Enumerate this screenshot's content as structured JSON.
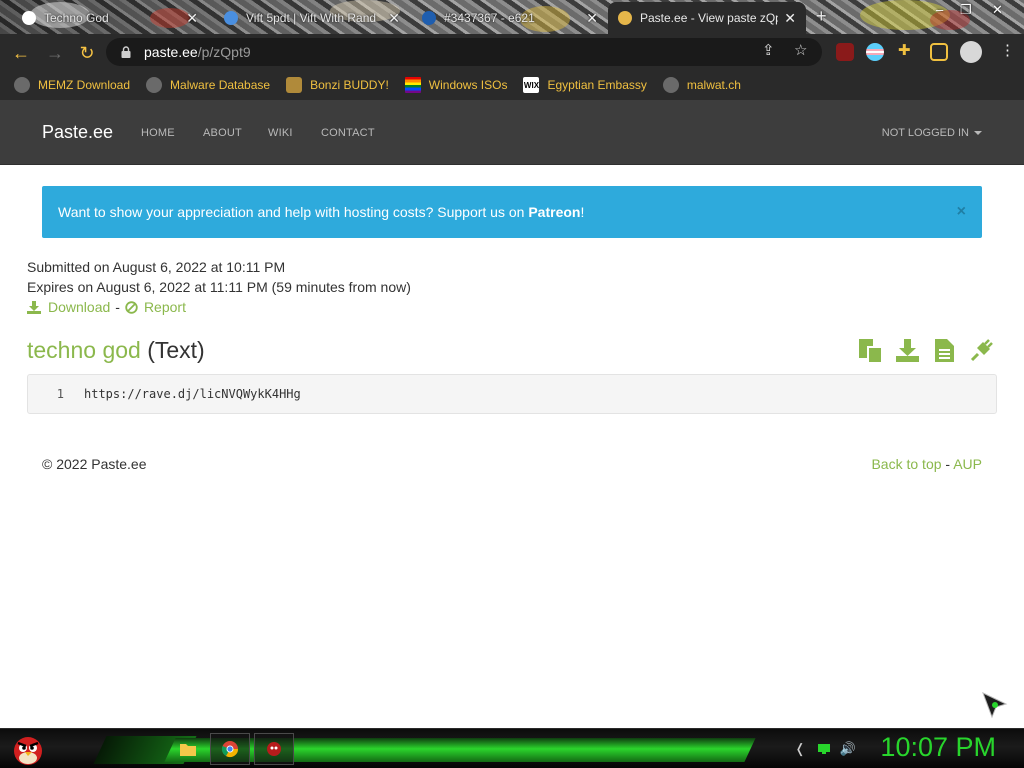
{
  "browser": {
    "tabs": [
      {
        "title": "Techno God",
        "favicon_color": "#ffffff",
        "active": false
      },
      {
        "title": "Vift 5pdt | Vift With Rand",
        "favicon_color": "#4a8fe0",
        "active": false
      },
      {
        "title": "#3437367 - e621",
        "favicon_color": "#1f5eaf",
        "active": false
      },
      {
        "title": "Paste.ee - View paste zQpt9",
        "favicon_color": "#e5b64a",
        "active": true
      }
    ],
    "new_tab": "+",
    "url_host": "paste.ee",
    "url_path": "/p/zQpt9",
    "extension_badge": "1",
    "bookmarks": [
      {
        "label": "MEMZ Download",
        "icon": "globe-icon",
        "color": "#6a6a6a"
      },
      {
        "label": "Malware Database",
        "icon": "globe-icon",
        "color": "#6a6a6a"
      },
      {
        "label": "Bonzi BUDDY!",
        "icon": "bonzi-icon",
        "color": "#b08a3a"
      },
      {
        "label": "Windows ISOs",
        "icon": "rainbow-flag-icon",
        "color": "#e04040"
      },
      {
        "label": "Egyptian Embassy",
        "icon": "wix-icon",
        "color": "#ffffff"
      },
      {
        "label": "malwat.ch",
        "icon": "globe-icon",
        "color": "#6a6a6a"
      }
    ]
  },
  "site": {
    "brand": "Paste.ee",
    "nav": [
      "HOME",
      "ABOUT",
      "WIKI",
      "CONTACT"
    ],
    "login": "NOT LOGGED IN",
    "accent": "#8bb84c",
    "alert": {
      "text": "Want to show your appreciation and help with hosting costs? Support us on ",
      "link": "Patreon",
      "suffix": "!",
      "close": "×",
      "color": "#2eaadc"
    },
    "submitted": "Submitted on August 6, 2022 at 10:11 PM",
    "expires": "Expires on August 6, 2022 at 11:11 PM (59 minutes from now)",
    "download": "Download",
    "sep": "-",
    "report": "Report",
    "paste_name": "techno god",
    "paste_type": "(Text)",
    "code_lines": [
      {
        "num": "1",
        "text": "https://rave.dj/licNVQWykK4HHg"
      }
    ],
    "copyright": "© 2022 Paste.ee",
    "back_to_top": "Back to top",
    "aup": "AUP"
  },
  "taskbar": {
    "clock": "10:07 PM",
    "glow_color": "#28d52c"
  }
}
